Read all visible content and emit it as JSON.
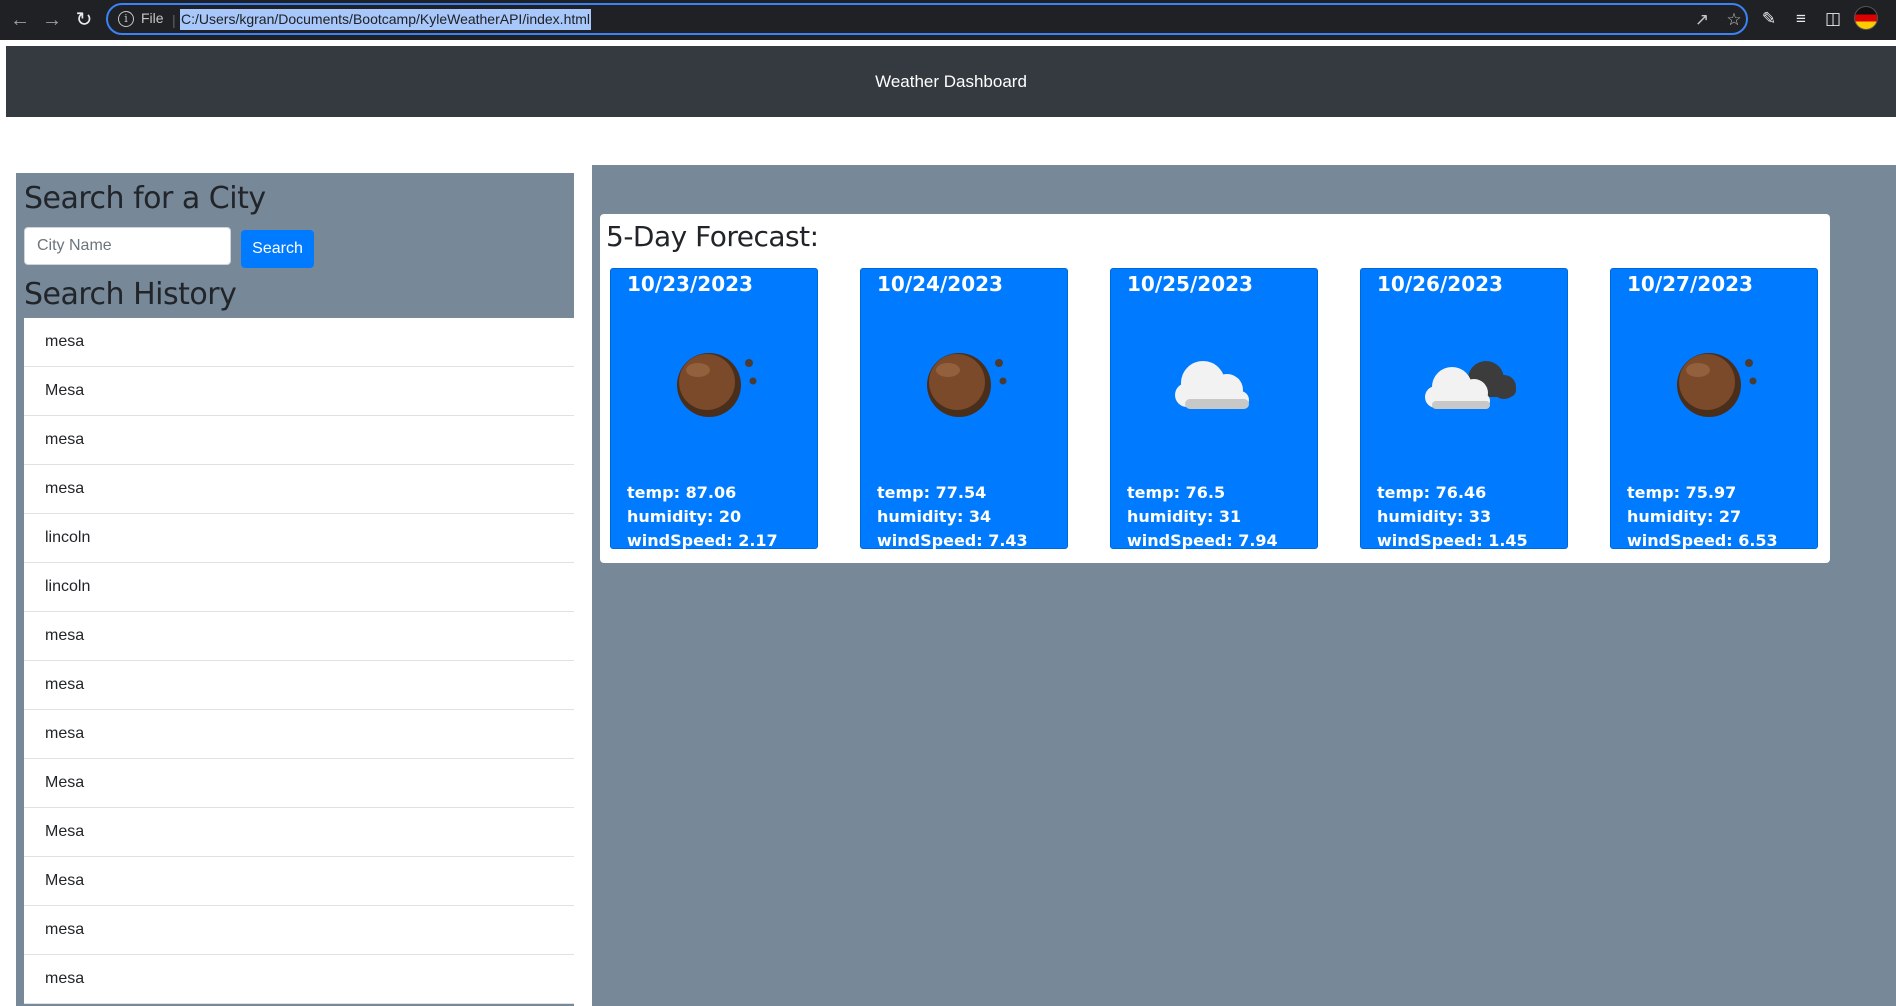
{
  "browser": {
    "file_label": "File",
    "url": "C:/Users/kgran/Documents/Bootcamp/KyleWeatherAPI/index.html"
  },
  "header": {
    "title": "Weather Dashboard"
  },
  "search": {
    "heading": "Search for a City",
    "placeholder": "City Name",
    "button_label": "Search"
  },
  "history": {
    "heading": "Search History",
    "items": [
      "mesa",
      "Mesa",
      "mesa",
      "mesa",
      "lincoln",
      "lincoln",
      "mesa",
      "mesa",
      "mesa",
      "Mesa",
      "Mesa",
      "Mesa",
      "mesa",
      "mesa"
    ]
  },
  "forecast": {
    "heading": "5-Day Forecast:",
    "days": [
      {
        "date": "10/23/2023",
        "icon": "clear-night-icon",
        "temp": "temp: 87.06",
        "humidity": "humidity: 20",
        "wind": "windSpeed: 2.17"
      },
      {
        "date": "10/24/2023",
        "icon": "clear-night-icon",
        "temp": "temp: 77.54",
        "humidity": "humidity: 34",
        "wind": "windSpeed: 7.43"
      },
      {
        "date": "10/25/2023",
        "icon": "cloud-icon",
        "temp": "temp: 76.5",
        "humidity": "humidity: 31",
        "wind": "windSpeed: 7.94"
      },
      {
        "date": "10/26/2023",
        "icon": "broken-clouds-icon",
        "temp": "temp: 76.46",
        "humidity": "humidity: 33",
        "wind": "windSpeed: 1.45"
      },
      {
        "date": "10/27/2023",
        "icon": "clear-night-icon",
        "temp": "temp: 75.97",
        "humidity": "humidity: 27",
        "wind": "windSpeed: 6.53"
      }
    ]
  },
  "colors": {
    "header_bg": "#343a40",
    "panel_bg": "#778899",
    "card_bg": "#007bff",
    "button_bg": "#007bff"
  }
}
